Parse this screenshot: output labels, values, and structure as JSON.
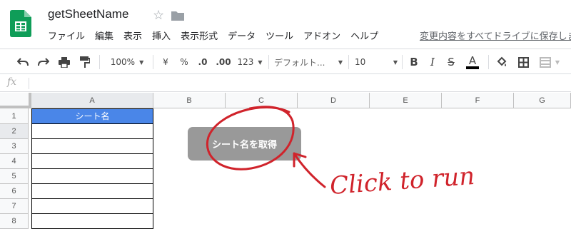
{
  "app": {
    "doc_title": "getSheetName",
    "save_status": "変更内容をすべてドライブに保存しました"
  },
  "menu": [
    "ファイル",
    "編集",
    "表示",
    "挿入",
    "表示形式",
    "データ",
    "ツール",
    "アドオン",
    "ヘルプ"
  ],
  "toolbar": {
    "zoom": "100%",
    "currency": "¥",
    "percent": "%",
    "decimal_decrease": ".0",
    "decimal_increase": ".00",
    "more_formats": "123",
    "font": "デフォルト...",
    "font_size": "10"
  },
  "formula_bar": {
    "fx": "fx"
  },
  "columns": [
    "A",
    "B",
    "C",
    "D",
    "E",
    "F",
    "G"
  ],
  "rows": [
    "1",
    "2",
    "3",
    "4",
    "5",
    "6",
    "7",
    "8"
  ],
  "sheet": {
    "A1": "シート名"
  },
  "button": {
    "label": "シート名を取得"
  },
  "annotation": {
    "text": "Click to run",
    "color": "#d0232b"
  },
  "colors": {
    "header_fill": "#4a86e8",
    "button_fill": "#999999",
    "logo_green": "#0f9d58"
  }
}
